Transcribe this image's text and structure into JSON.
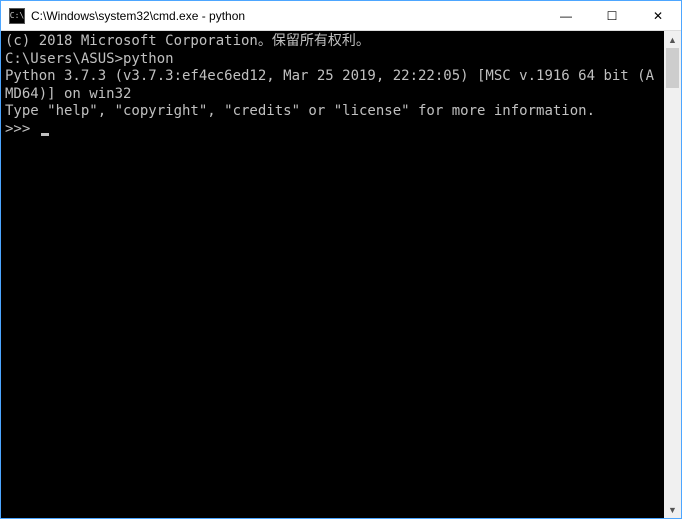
{
  "titlebar": {
    "icon_label": "C:\\",
    "title": "C:\\Windows\\system32\\cmd.exe - python"
  },
  "window_controls": {
    "minimize": "—",
    "maximize": "☐",
    "close": "✕"
  },
  "terminal": {
    "lines": [
      "(c) 2018 Microsoft Corporation。保留所有权利。",
      "",
      "C:\\Users\\ASUS>python",
      "Python 3.7.3 (v3.7.3:ef4ec6ed12, Mar 25 2019, 22:22:05) [MSC v.1916 64 bit (AMD64)] on win32",
      "Type \"help\", \"copyright\", \"credits\" or \"license\" for more information.",
      ">>> "
    ]
  }
}
